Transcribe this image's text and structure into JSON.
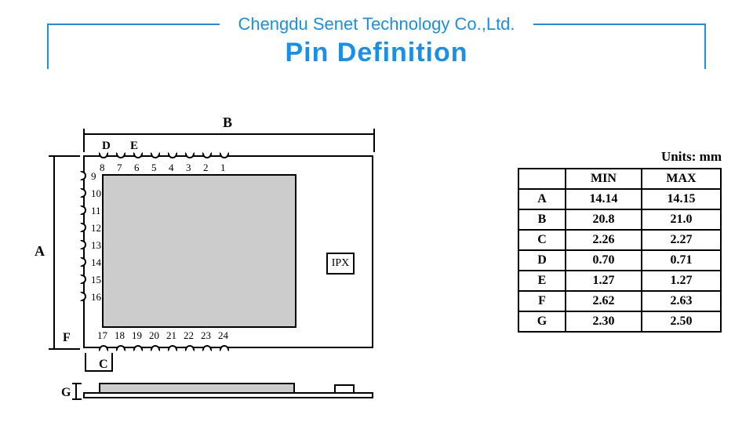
{
  "header": {
    "company": "Chengdu Senet Technology Co.,Ltd.",
    "title": "Pin Definition"
  },
  "diagram": {
    "ipx_label": "IPX",
    "dim_labels": {
      "A": "A",
      "B": "B",
      "C": "C",
      "D": "D",
      "E": "E",
      "F": "F",
      "G": "G"
    },
    "pins_top": [
      "8",
      "7",
      "6",
      "5",
      "4",
      "3",
      "2",
      "1"
    ],
    "pins_left": [
      "9",
      "10",
      "11",
      "12",
      "13",
      "14",
      "15",
      "16"
    ],
    "pins_bottom": [
      "17",
      "18",
      "19",
      "20",
      "21",
      "22",
      "23",
      "24"
    ]
  },
  "table": {
    "units": "Units: mm",
    "head": [
      "",
      "MIN",
      "MAX"
    ],
    "rows": [
      {
        "k": "A",
        "min": "14.14",
        "max": "14.15"
      },
      {
        "k": "B",
        "min": "20.8",
        "max": "21.0"
      },
      {
        "k": "C",
        "min": "2.26",
        "max": "2.27"
      },
      {
        "k": "D",
        "min": "0.70",
        "max": "0.71"
      },
      {
        "k": "E",
        "min": "1.27",
        "max": "1.27"
      },
      {
        "k": "F",
        "min": "2.62",
        "max": "2.63"
      },
      {
        "k": "G",
        "min": "2.30",
        "max": "2.50"
      }
    ]
  }
}
